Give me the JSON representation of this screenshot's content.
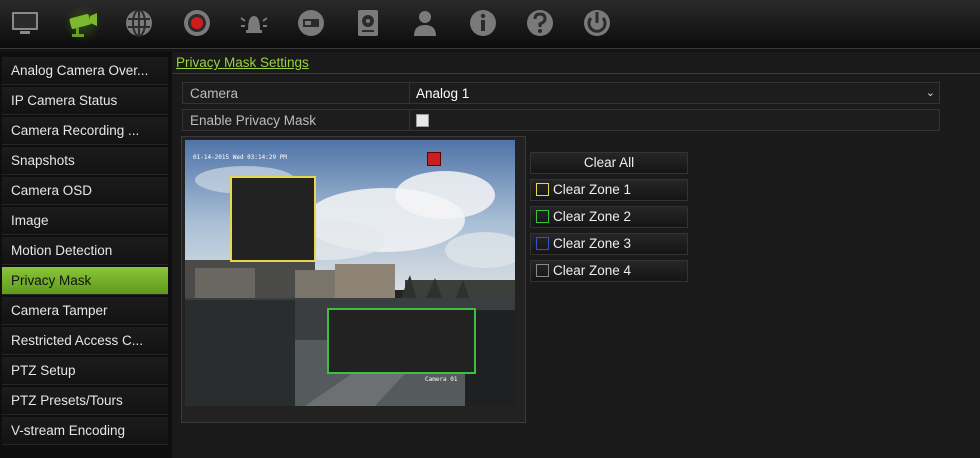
{
  "toolbar": {
    "icons": [
      {
        "name": "monitor-icon"
      },
      {
        "name": "camera-icon"
      },
      {
        "name": "network-icon"
      },
      {
        "name": "record-icon"
      },
      {
        "name": "alarm-icon"
      },
      {
        "name": "device-icon"
      },
      {
        "name": "storage-icon"
      },
      {
        "name": "user-icon"
      },
      {
        "name": "info-icon"
      },
      {
        "name": "help-icon"
      },
      {
        "name": "power-icon"
      }
    ]
  },
  "sidebar": {
    "items": [
      {
        "label": "Analog Camera Over..."
      },
      {
        "label": "IP Camera Status"
      },
      {
        "label": "Camera Recording ..."
      },
      {
        "label": "Snapshots"
      },
      {
        "label": "Camera OSD"
      },
      {
        "label": "Image"
      },
      {
        "label": "Motion Detection"
      },
      {
        "label": "Privacy Mask"
      },
      {
        "label": "Camera Tamper"
      },
      {
        "label": "Restricted Access C..."
      },
      {
        "label": "PTZ Setup"
      },
      {
        "label": "PTZ Presets/Tours"
      },
      {
        "label": "V-stream Encoding"
      }
    ],
    "active_index": 7
  },
  "main": {
    "section_title": "Privacy Mask Settings",
    "camera_label": "Camera",
    "camera_value": "Analog 1",
    "enable_label": "Enable Privacy Mask",
    "enable_checked": false,
    "preview": {
      "timestamp": "01-14-2015 Wed 03:14:29 PM",
      "camera_name": "Camera 01"
    },
    "clear_all_label": "Clear All",
    "zones": [
      {
        "label": "Clear Zone 1",
        "color": "#e6d84a"
      },
      {
        "label": "Clear Zone 2",
        "color": "#3fbf3f"
      },
      {
        "label": "Clear Zone 3",
        "color": "#2a56c8"
      },
      {
        "label": "Clear Zone 4",
        "color": "#888888"
      }
    ]
  },
  "colors": {
    "accent": "#8bc53a",
    "title": "#9ad33b"
  }
}
